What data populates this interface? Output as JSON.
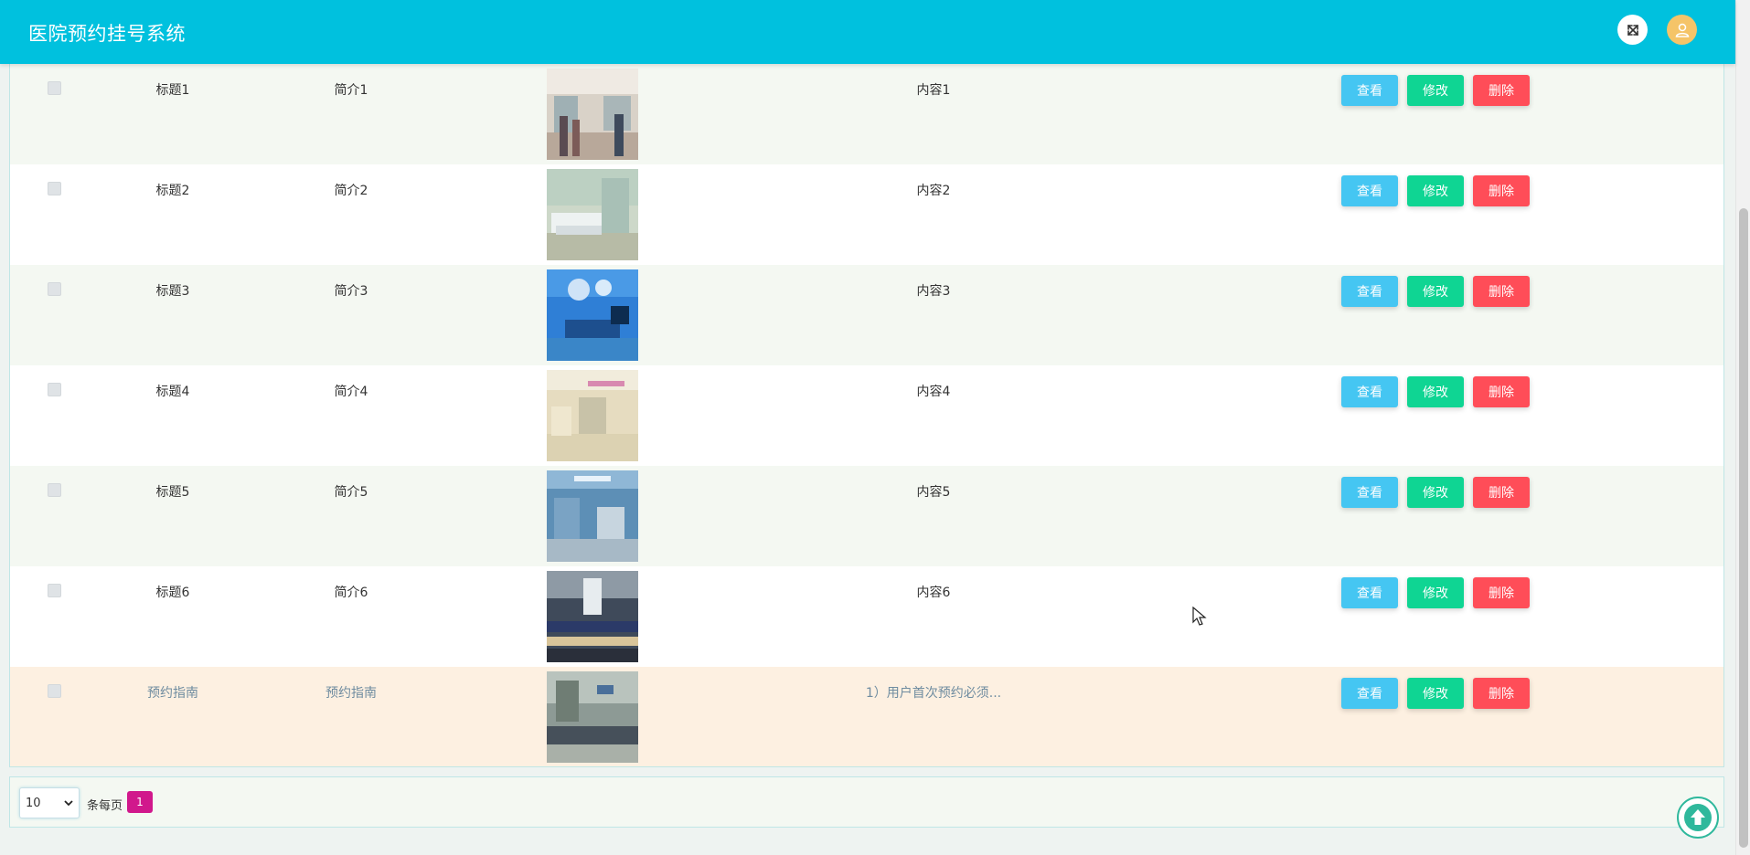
{
  "header": {
    "title": "医院预约挂号系统",
    "fullscreen_icon": "expand-arrows-icon",
    "avatar_icon": "user-icon"
  },
  "table": {
    "rows": [
      {
        "title": "标题1",
        "intro": "简介1",
        "content": "内容1",
        "image": "hospital-lobby-photo"
      },
      {
        "title": "标题2",
        "intro": "简介2",
        "content": "内容2",
        "image": "hospital-ward-photo"
      },
      {
        "title": "标题3",
        "intro": "简介3",
        "content": "内容3",
        "image": "operating-room-photo"
      },
      {
        "title": "标题4",
        "intro": "简介4",
        "content": "内容4",
        "image": "hospital-corridor-photo"
      },
      {
        "title": "标题5",
        "intro": "简介5",
        "content": "内容5",
        "image": "treatment-room-photo"
      },
      {
        "title": "标题6",
        "intro": "简介6",
        "content": "内容6",
        "image": "waiting-hall-photo"
      },
      {
        "title": "预约指南",
        "intro": "预约指南",
        "content": "1）用户首次预约必须...",
        "image": "waiting-area-photo"
      }
    ],
    "actions": {
      "view": "查看",
      "edit": "修改",
      "delete": "删除"
    }
  },
  "pager": {
    "page_size": "10",
    "per_page_label": "条每页",
    "current_page": "1"
  },
  "colors": {
    "header": "#00c1de",
    "view_button": "#45c6f2",
    "edit_button": "#0fd593",
    "delete_button": "#ff4d58",
    "current_page": "#d1188c",
    "highlight_row": "#fdf0e1"
  }
}
